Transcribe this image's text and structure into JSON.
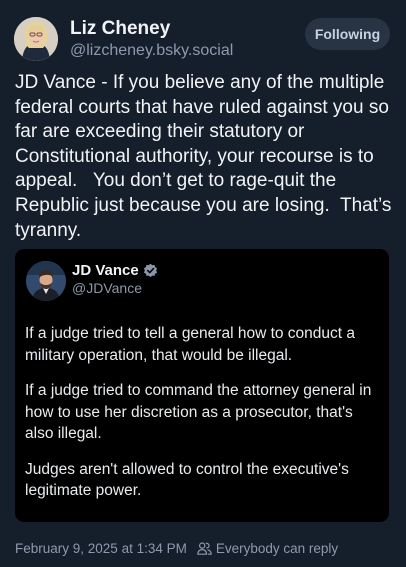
{
  "author": {
    "name": "Liz Cheney",
    "handle": "@lizcheney.bsky.social",
    "avatar_icon": "profile-photo"
  },
  "follow_button": {
    "label": "Following"
  },
  "post": {
    "text": "JD Vance - If you believe any of the multiple federal courts that have ruled against you so far are exceeding their statutory or Constitutional authority, your recourse is to appeal.   You don’t get to rage-quit the Republic just because you are losing.  That’s tyranny."
  },
  "quoted_post": {
    "author_name": "JD Vance",
    "author_handle": "@JDVance",
    "verified_icon": "verified-badge-icon",
    "paragraphs": [
      "If a judge tried to tell a general how to conduct a military operation, that would be illegal.",
      "If a judge tried to command the attorney general in how to use her discretion as a prosecutor, that's also illegal.",
      "Judges aren't allowed to control the executive's legitimate power."
    ]
  },
  "meta": {
    "timestamp": "February 9, 2025 at 1:34 PM",
    "reply_setting": "Everybody can reply",
    "reply_icon": "people-icon"
  },
  "colors": {
    "background": "#151e2b",
    "quote_background": "#000000",
    "secondary_text": "#8d9aab",
    "verified": "#1d9bf0"
  }
}
